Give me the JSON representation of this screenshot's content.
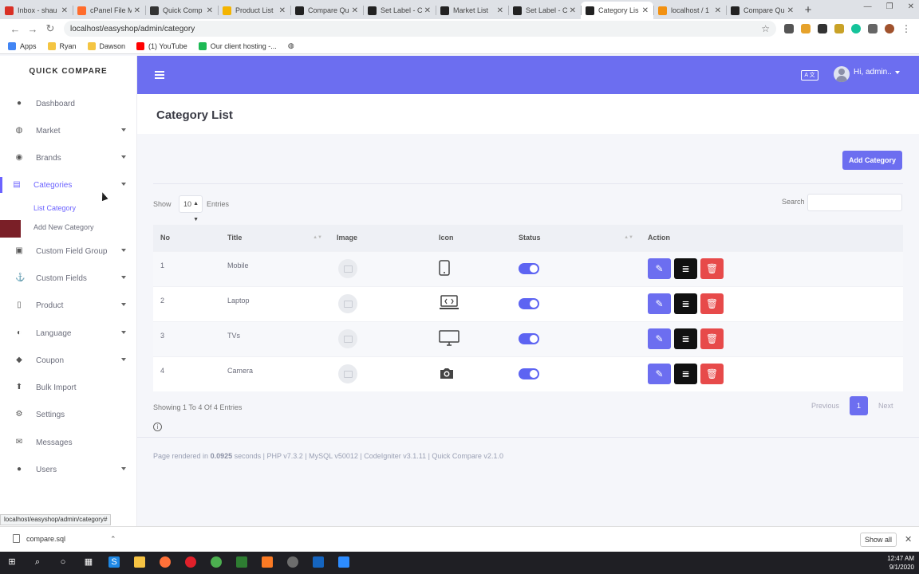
{
  "browser": {
    "tabs": [
      {
        "label": "Inbox - shau",
        "color": "#d93025"
      },
      {
        "label": "cPanel File M",
        "color": "#ff6c2c"
      },
      {
        "label": "Quick Comp",
        "color": "#333333"
      },
      {
        "label": "Product List",
        "color": "#f4b400"
      },
      {
        "label": "Compare Qu",
        "color": "#222222"
      },
      {
        "label": "Set Label - C",
        "color": "#222222"
      },
      {
        "label": "Market List",
        "color": "#222222"
      },
      {
        "label": "Set Label - C",
        "color": "#222222"
      },
      {
        "label": "Category Lis",
        "color": "#222222",
        "active": true
      },
      {
        "label": "localhost / 1",
        "color": "#f29111"
      },
      {
        "label": "Compare Qu",
        "color": "#222222"
      }
    ],
    "url": "localhost/easyshop/admin/category",
    "bookmarks": [
      {
        "label": "Apps",
        "color": "#4285f4"
      },
      {
        "label": "Ryan",
        "color": "#f4c542"
      },
      {
        "label": "Dawson",
        "color": "#f4c542"
      },
      {
        "label": "(1) YouTube",
        "color": "#ff0000"
      },
      {
        "label": "Our client hosting -...",
        "color": "#1db954"
      }
    ],
    "status_url": "localhost/easyshop/admin/category#"
  },
  "sidebar": {
    "brand": "QUICK COMPARE",
    "items": [
      {
        "label": "Dashboard",
        "icon": "fire-icon",
        "glyph": "●",
        "caret": false
      },
      {
        "label": "Market",
        "icon": "globe-icon",
        "glyph": "◍",
        "caret": true
      },
      {
        "label": "Brands",
        "icon": "tag-icon",
        "glyph": "◉",
        "caret": true
      },
      {
        "label": "Categories",
        "icon": "list-icon",
        "glyph": "▤",
        "caret": true,
        "active": true
      },
      {
        "label": "Custom Field Group",
        "icon": "group-icon",
        "glyph": "▣",
        "caret": true
      },
      {
        "label": "Custom Fields",
        "icon": "anchor-icon",
        "glyph": "⚓",
        "caret": true
      },
      {
        "label": "Product",
        "icon": "mobile-icon",
        "glyph": "▯",
        "caret": true
      },
      {
        "label": "Language",
        "icon": "language-icon",
        "glyph": "◐",
        "caret": true
      },
      {
        "label": "Coupon",
        "icon": "ticket-icon",
        "glyph": "◆",
        "caret": true
      },
      {
        "label": "Bulk Import",
        "icon": "upload-icon",
        "glyph": "⬆",
        "caret": false
      },
      {
        "label": "Settings",
        "icon": "gear-icon",
        "glyph": "⚙",
        "caret": false
      },
      {
        "label": "Messages",
        "icon": "envelope-icon",
        "glyph": "✉",
        "caret": false
      },
      {
        "label": "Users",
        "icon": "user-icon",
        "glyph": "●",
        "caret": true
      }
    ],
    "subitems": [
      "List Category",
      "Add New Category"
    ]
  },
  "header": {
    "lang_badge": "A 文",
    "user_greeting": "Hi, admin.."
  },
  "page": {
    "title": "Category List",
    "add_button": "Add Category",
    "show_label": "Show",
    "page_size": "10",
    "entries_label": "Entries",
    "search_label": "Search",
    "columns": [
      "No",
      "Title",
      "Image",
      "Icon",
      "Status",
      "Action"
    ],
    "rows": [
      {
        "no": "1",
        "title": "Mobile",
        "icon": "mobile-icon",
        "status": true
      },
      {
        "no": "2",
        "title": "Laptop",
        "icon": "laptop-icon",
        "status": true
      },
      {
        "no": "3",
        "title": "TVs",
        "icon": "tv-icon",
        "status": true
      },
      {
        "no": "4",
        "title": "Camera",
        "icon": "camera-icon",
        "status": true
      }
    ],
    "info": "Showing 1 To 4 Of 4 Entries",
    "pagination": {
      "prev": "Previous",
      "current": "1",
      "next": "Next"
    }
  },
  "footer": {
    "prefix": "Page rendered in ",
    "time": "0.0925",
    "suffix": " seconds | PHP v7.3.2 | MySQL v50012 | CodeIgniter v3.1.11 | Quick Compare v2.1.0"
  },
  "downloads": {
    "file": "compare.sql",
    "show_all": "Show all"
  },
  "taskbar": {
    "time": "12:47 AM",
    "date": "9/1/2020"
  },
  "colors": {
    "accent": "#6c6ef0",
    "danger": "#e74a4a",
    "dark": "#111111"
  }
}
